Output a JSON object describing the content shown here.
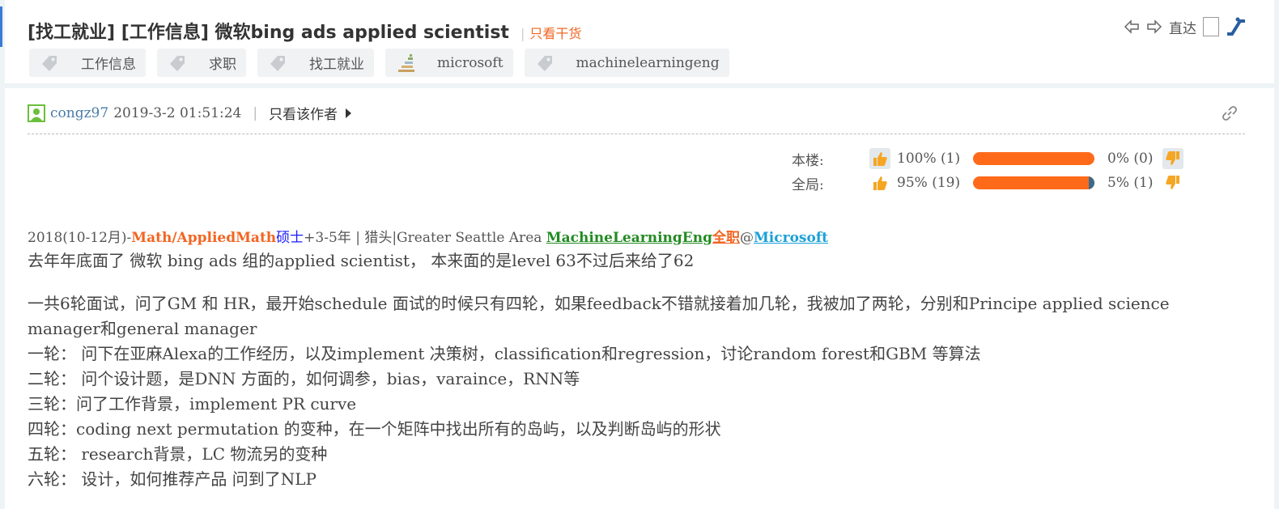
{
  "thread": {
    "title": "[找工就业] [工作信息] 微软bing ads applied scientist",
    "title_sep": "|",
    "only_good": "只看干货",
    "goto_label": "直达"
  },
  "tags": [
    {
      "label": "工作信息",
      "icon": "tag-icon"
    },
    {
      "label": "求职",
      "icon": "tag-icon"
    },
    {
      "label": "找工就业",
      "icon": "tag-icon"
    },
    {
      "label": "microsoft",
      "icon": "ladder-icon"
    },
    {
      "label": "machinelearningeng",
      "icon": "tag-icon"
    }
  ],
  "post": {
    "author": "congz97",
    "date": "2019-3-2 01:51:24",
    "meta_sep": "|",
    "only_author": "只看该作者"
  },
  "votes": {
    "floor": {
      "label": "本楼:",
      "up": "100% (1)",
      "down": "0% (0)",
      "up_fraction": 1.0
    },
    "global": {
      "label": "全局:",
      "up": "95% (19)",
      "down": "5% (1)",
      "up_fraction": 0.95
    }
  },
  "info": {
    "period": "2018(10-12月)-",
    "major": "Math/AppliedMath",
    "degree": "硕士",
    "exp": "+3-5年 | 猎头|Greater Seattle Area ",
    "position": "MachineLearningEng",
    "type": "全职",
    "at": "@",
    "company": "Microsoft"
  },
  "content": {
    "p1": "去年年底面了 微软 bing ads 组的applied scientist， 本来面的是level 63不过后来给了62",
    "p2": "一共6轮面试，问了GM 和 HR，最开始schedule 面试的时候只有四轮，如果feedback不错就接着加几轮，我被加了两轮，分别和Principe applied science manager和general manager",
    "r1": "一轮： 问下在亚麻Alexa的工作经历，以及implement 决策树，classification和regression，讨论random forest和GBM 等算法",
    "r2": "二轮： 问个设计题，是DNN 方面的，如何调参，bias，varaince，RNN等",
    "r3": "三轮：问了工作背景，implement PR curve",
    "r4": "四轮：coding next permutation 的变种，在一个矩阵中找出所有的岛屿，以及判断岛屿的形状",
    "r5": "五轮： research背景，LC 物流另的变种",
    "r6": "六轮： 设计，如何推荐产品 问到了NLP"
  },
  "colors": {
    "accent": "#f26522",
    "bar": "#ff6a1a",
    "link": "#4a7ba7"
  }
}
